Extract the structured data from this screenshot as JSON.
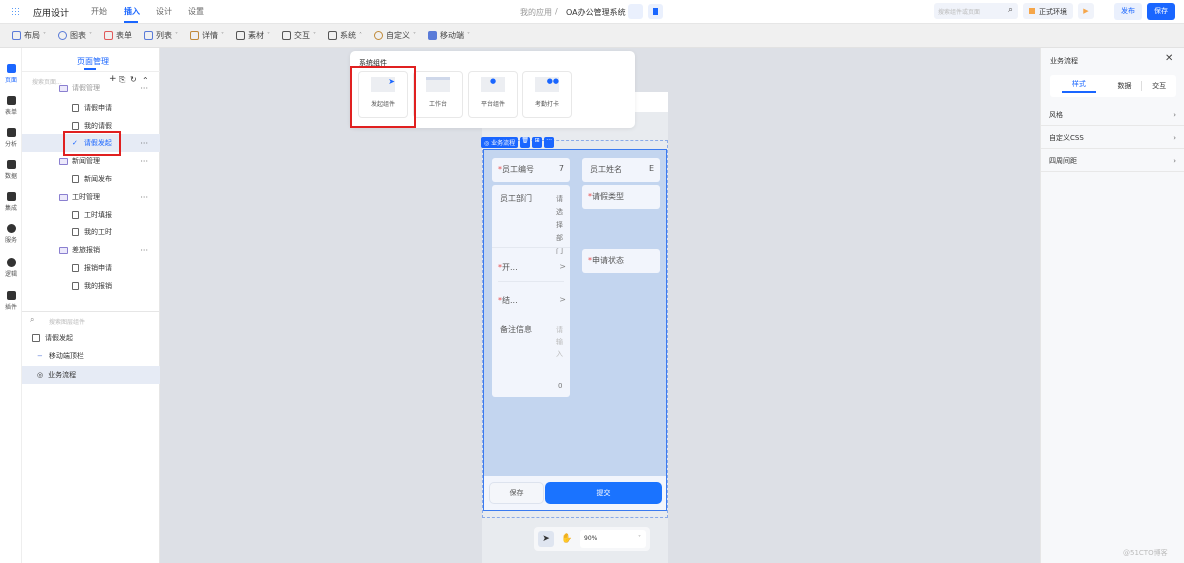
{
  "topbar": {
    "app_title": "应用设计",
    "tabs": [
      "开始",
      "插入",
      "设计",
      "设置"
    ],
    "active_tab": "插入",
    "breadcrumb_root": "我的应用",
    "breadcrumb_sep": "/",
    "app_name": "OA办公管理系统",
    "search_placeholder": "搜索组件或页面",
    "env_label": "正式环境",
    "publish": "发布",
    "save": "保存"
  },
  "toolbar": {
    "items": [
      {
        "label": "布局",
        "chev": "˅"
      },
      {
        "label": "图表",
        "chev": "˅"
      },
      {
        "label": "表单",
        "chev": ""
      },
      {
        "label": "列表",
        "chev": "˅"
      },
      {
        "label": "详情",
        "chev": "˅"
      },
      {
        "label": "素材",
        "chev": "˅"
      },
      {
        "label": "交互",
        "chev": "˅"
      },
      {
        "label": "系统",
        "chev": "˄"
      },
      {
        "label": "自定义",
        "chev": "˅"
      },
      {
        "label": "移动端",
        "chev": "˅"
      }
    ]
  },
  "rail": [
    "页面",
    "表单",
    "分析",
    "数据",
    "集成",
    "服务",
    "逻辑",
    "插件"
  ],
  "left_panel": {
    "tab": "页面管理",
    "search_placeholder": "搜索页面...",
    "tools": [
      "+",
      "⎘",
      "↻",
      "⌃"
    ],
    "tree": [
      {
        "label": "请假管理",
        "type": "folder"
      },
      {
        "label": "请假申请",
        "type": "page"
      },
      {
        "label": "我的请假",
        "type": "page"
      },
      {
        "label": "请假发起",
        "type": "selected"
      },
      {
        "label": "新闻管理",
        "type": "folder"
      },
      {
        "label": "新闻发布",
        "type": "page"
      },
      {
        "label": "工时管理",
        "type": "folder"
      },
      {
        "label": "工时填报",
        "type": "page"
      },
      {
        "label": "我的工时",
        "type": "page"
      },
      {
        "label": "差旅报销",
        "type": "folder"
      },
      {
        "label": "报销申请",
        "type": "page"
      },
      {
        "label": "我的报销",
        "type": "page"
      }
    ],
    "layer_search_placeholder": "搜索图层组件",
    "layers": [
      "请假发起",
      "移动端顶栏",
      "业务流程"
    ]
  },
  "popover": {
    "title": "系统组件",
    "items": [
      "发起组件",
      "工作台",
      "平台组件",
      "考勤打卡"
    ]
  },
  "form": {
    "tag": "业务流程",
    "fields": {
      "emp_no": "员工编号",
      "emp_no_val": "7",
      "emp_name": "员工姓名",
      "emp_name_val": "E",
      "dept": "员工部门",
      "dept_val": "请选择部门",
      "leave_type": "请假类型",
      "start": "开...",
      "end": "结...",
      "status": "申请状态",
      "remark": "备注信息",
      "remark_ph": "请输入",
      "count": "0"
    },
    "save": "保存",
    "submit": "提交"
  },
  "zoom": {
    "value": "90%"
  },
  "right_panel": {
    "title": "业务流程",
    "tabs": [
      "样式",
      "数据",
      "交互"
    ],
    "rows": [
      "风格",
      "自定义CSS",
      "四周间距"
    ]
  },
  "watermark": "@51CTO博客"
}
